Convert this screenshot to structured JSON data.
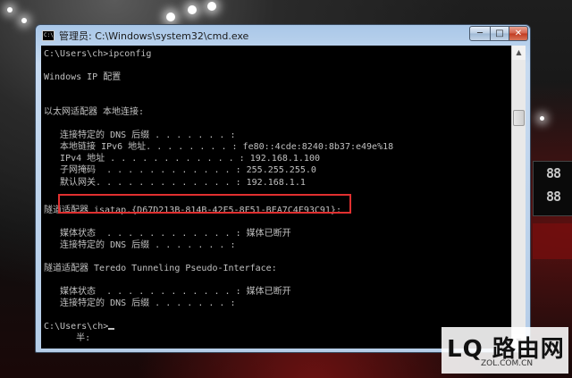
{
  "window": {
    "title": "管理员: C:\\Windows\\system32\\cmd.exe",
    "icon_text": "C:\\",
    "controls": {
      "minimize": "─",
      "maximize": "□",
      "close": "✕"
    }
  },
  "console": {
    "lines": [
      "C:\\Users\\ch>ipconfig",
      "",
      "Windows IP 配置",
      "",
      "",
      "以太网适配器 本地连接:",
      "",
      "   连接特定的 DNS 后缀 . . . . . . . :",
      "   本地链接 IPv6 地址. . . . . . . . : fe80::4cde:8240:8b37:e49e%18",
      "   IPv4 地址 . . . . . . . . . . . . : 192.168.1.100",
      "   子网掩码  . . . . . . . . . . . . : 255.255.255.0",
      "   默认网关. . . . . . . . . . . . . : 192.168.1.1",
      "",
      "隧道适配器 isatap.{D67D213B-814B-42F5-8F51-BEA7C4F93C91}:",
      "",
      "   媒体状态  . . . . . . . . . . . . : 媒体已断开",
      "   连接特定的 DNS 后缀 . . . . . . . :",
      "",
      "隧道适配器 Teredo Tunneling Pseudo-Interface:",
      "",
      "   媒体状态  . . . . . . . . . . . . : 媒体已断开",
      "   连接特定的 DNS 后缀 . . . . . . . :",
      "",
      "C:\\Users\\ch>",
      "      半:"
    ]
  },
  "highlight": {
    "color": "#e03030",
    "target": "default-gateway"
  },
  "watermark": {
    "logo": "LQ 路由网",
    "site": "ZOL.COM.CN"
  },
  "backdrop": {
    "scoreboard_top": "88",
    "scoreboard_bottom": "88"
  },
  "colors": {
    "console_bg": "#000000",
    "console_fg": "#c0c0c0"
  }
}
